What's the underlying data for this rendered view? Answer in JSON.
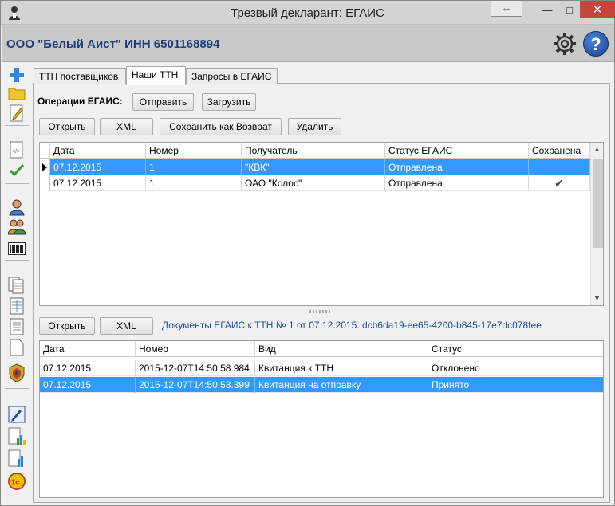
{
  "window": {
    "title": "Трезвый декларант: ЕГАИС",
    "icons": {
      "app": "user-icon",
      "restore": "resize-icon",
      "minimize": "minimize-icon",
      "maximize": "maximize-icon",
      "close": "close-icon"
    }
  },
  "header": {
    "company": "ООО \"Белый Аист\" ИНН 6501168894",
    "settings_icon": "gear-icon",
    "help_label": "?"
  },
  "toolbar": {
    "icons": [
      "add-icon",
      "folder-icon",
      "edit-icon",
      "xml-doc-icon",
      "check-icon",
      "user-icon",
      "users-icon",
      "barcode-icon",
      "documents-icon",
      "table-icon",
      "document-icon",
      "blank-page-icon",
      "emblem-icon",
      "pen-icon",
      "report-chart-icon",
      "report-chart-alt-icon",
      "1c-icon"
    ]
  },
  "tabs": [
    {
      "label": "ТТН поставщиков",
      "active": false
    },
    {
      "label": "Наши ТТН",
      "active": true
    },
    {
      "label": "Запросы в ЕГАИС",
      "active": false
    }
  ],
  "operations": {
    "label": "Операции ЕГАИС:",
    "send": "Отправить",
    "load": "Загрузить"
  },
  "top_actions": {
    "open": "Открыть",
    "xml": "XML",
    "save_return": "Сохранить как Возврат",
    "delete": "Удалить"
  },
  "top_grid": {
    "columns": [
      "Дата",
      "Номер",
      "Получатель",
      "Статус ЕГАИС",
      "Сохранена"
    ],
    "rows": [
      {
        "date": "07.12.2015",
        "number": "1",
        "recipient": "\"КВК\"",
        "status": "Отправлена",
        "saved": "",
        "selected": true
      },
      {
        "date": "07.12.2015",
        "number": "1",
        "recipient": "ОАО \"Колос\"",
        "status": "Отправлена",
        "saved": "✔",
        "selected": false
      }
    ]
  },
  "bottom_actions": {
    "open": "Открыть",
    "xml": "XML"
  },
  "documents_info": "Документы ЕГАИС к ТТН № 1 от 07.12.2015. dcb6da19-ee65-4200-b845-17e7dc078fee",
  "bottom_grid": {
    "columns": [
      "Дата",
      "Номер",
      "Вид",
      "Статус"
    ],
    "rows": [
      {
        "date": "07.12.2015",
        "number": "2015-12-07T14:50:58.984",
        "kind": "Квитанция к ТТН",
        "status": "Отклонено",
        "selected": false
      },
      {
        "date": "07.12.2015",
        "number": "2015-12-07T14:50:53.399",
        "kind": "Квитанция на отправку",
        "status": "Принято",
        "selected": true
      }
    ]
  },
  "colors": {
    "selection": "#3399ff",
    "company_text": "#1c3d77",
    "info_text": "#1f4e9c",
    "close": "#c7463b"
  }
}
